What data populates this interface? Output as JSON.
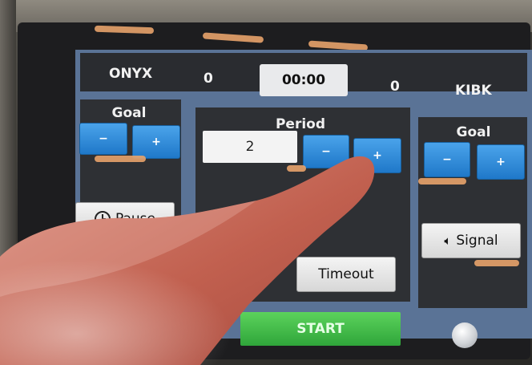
{
  "scoreboard": {
    "home_team": "ONYX",
    "home_score": "0",
    "clock": "00:00",
    "away_score": "0",
    "away_team": "KIBK"
  },
  "left_goal": {
    "label": "Goal",
    "minus": "−",
    "plus": "+"
  },
  "period": {
    "label": "Period",
    "value": "2",
    "minus": "−",
    "plus": "+"
  },
  "right_goal": {
    "label": "Goal",
    "minus": "−",
    "plus": "+"
  },
  "controls": {
    "pause_label": "Pause",
    "pause_icon": "clock-icon",
    "timeout_label": "Timeout",
    "signal_label": "Signal",
    "signal_icon": "speaker-icon",
    "start_label": "START",
    "ball_icon": "ball-icon"
  },
  "colors": {
    "accent_blue": "#1f78c9",
    "start_green": "#2fa53a",
    "panel_frame": "#5a7396",
    "tape": "#e8a36a"
  }
}
